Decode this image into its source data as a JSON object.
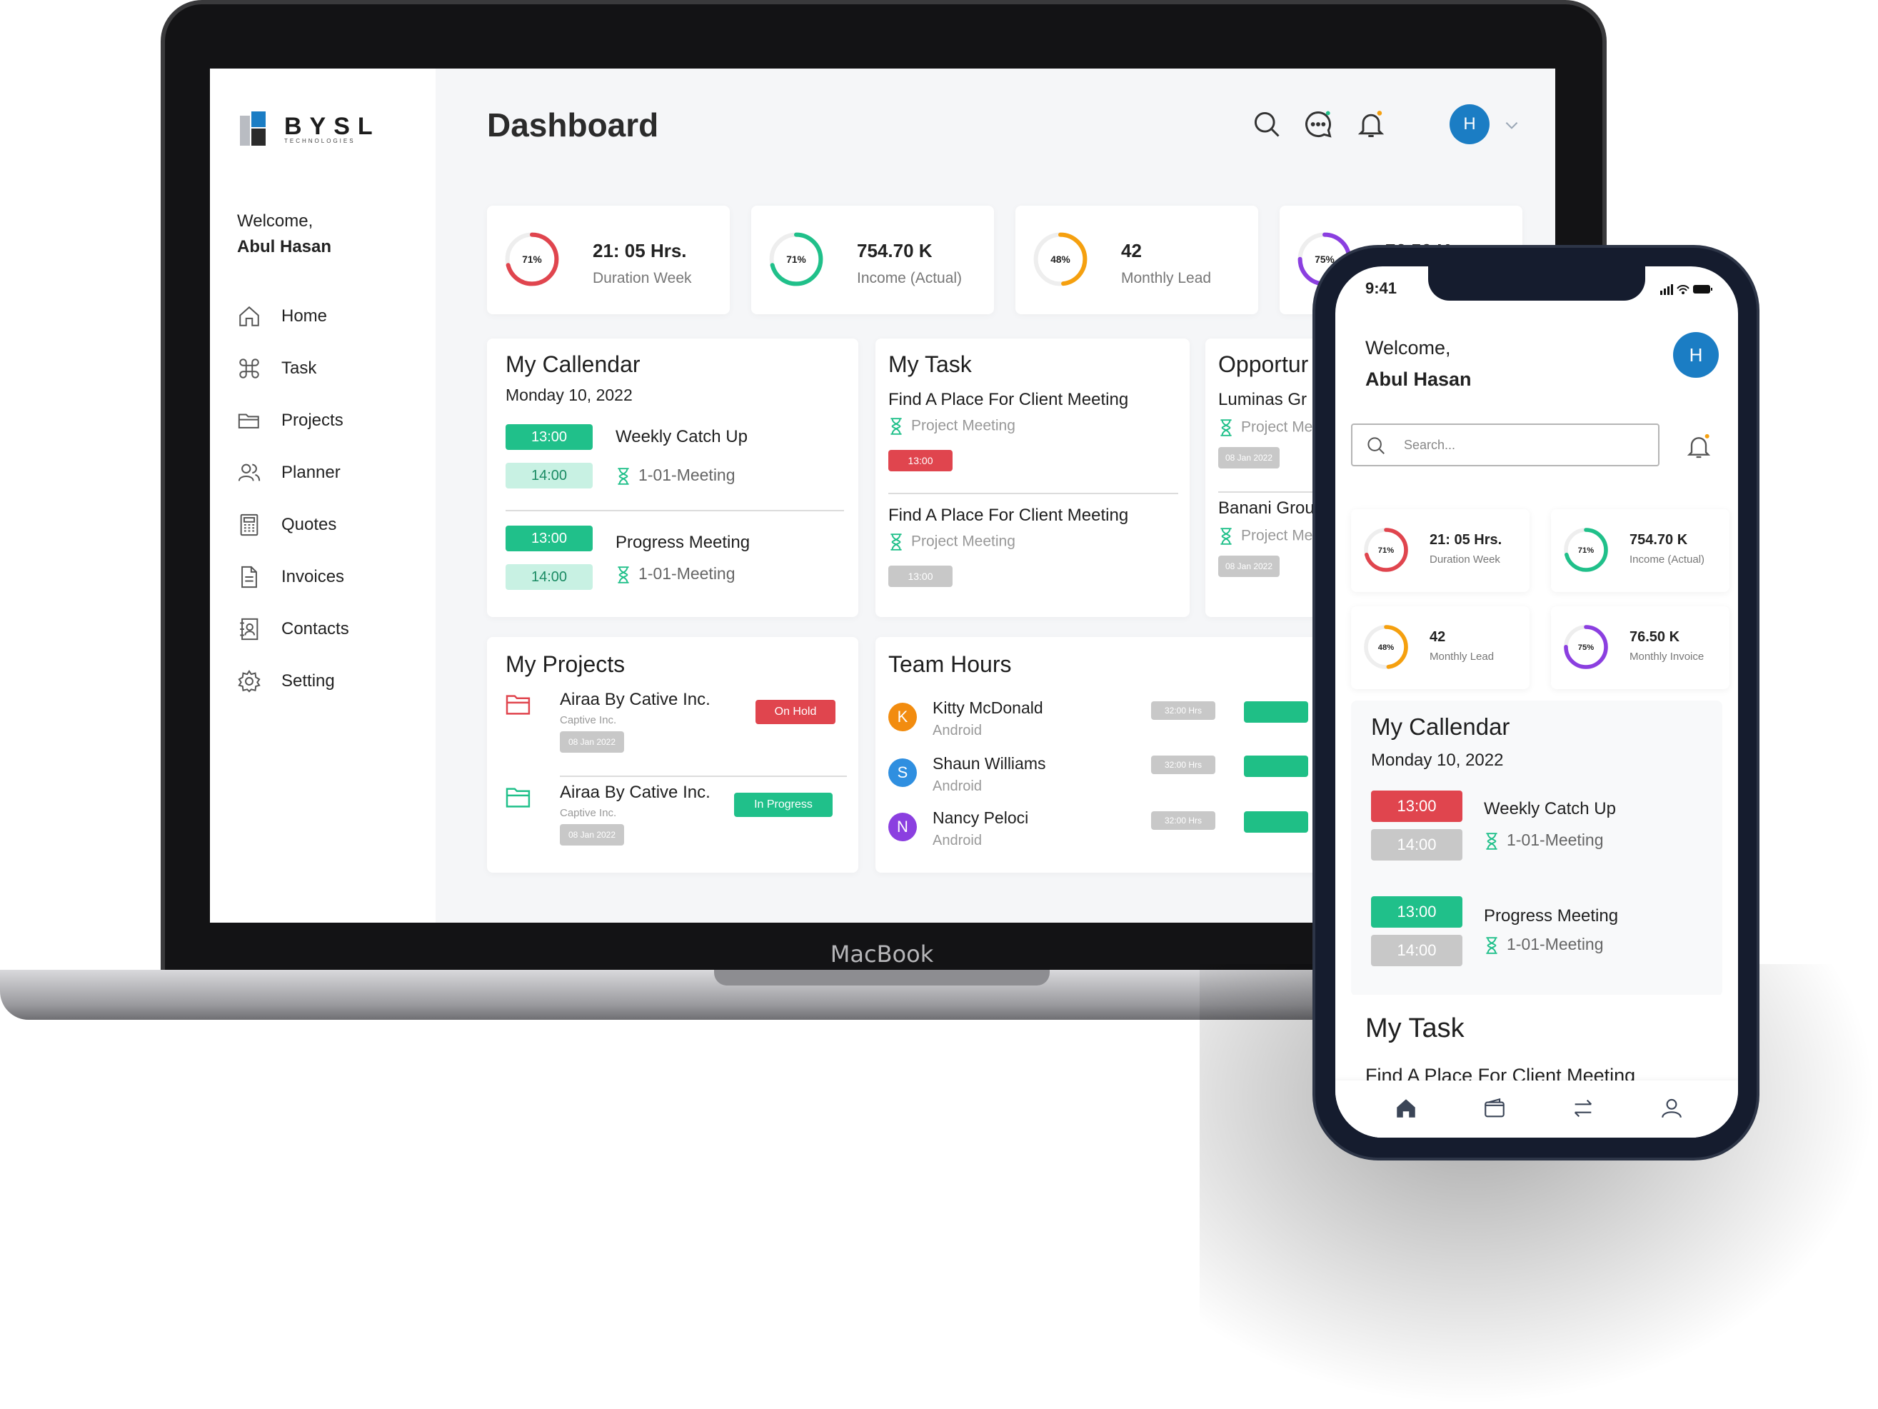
{
  "device_label": "MacBook",
  "brand": {
    "name": "BYSL",
    "tagline": "TECHNOLOGIES"
  },
  "welcome": {
    "greeting": "Welcome,",
    "name": "Abul Hasan"
  },
  "nav": [
    {
      "label": "Home",
      "icon": "home-icon"
    },
    {
      "label": "Task",
      "icon": "command-icon"
    },
    {
      "label": "Projects",
      "icon": "folder-icon"
    },
    {
      "label": "Planner",
      "icon": "users-icon"
    },
    {
      "label": "Quotes",
      "icon": "calculator-icon"
    },
    {
      "label": "Invoices",
      "icon": "document-icon"
    },
    {
      "label": "Contacts",
      "icon": "contact-book-icon"
    },
    {
      "label": "Setting",
      "icon": "gear-icon"
    }
  ],
  "header": {
    "title": "Dashboard",
    "avatar_initial": "H"
  },
  "stats": [
    {
      "percent_label": "71%",
      "percent": 0.71,
      "value": "21: 05 Hrs.",
      "label": "Duration Week",
      "color": "#e0454e"
    },
    {
      "percent_label": "71%",
      "percent": 0.71,
      "value": "754.70 K",
      "label": "Income (Actual)",
      "color": "#20c08a"
    },
    {
      "percent_label": "48%",
      "percent": 0.48,
      "value": "42",
      "label": "Monthly Lead",
      "color": "#f5a00f"
    },
    {
      "percent_label": "75%",
      "percent": 0.75,
      "value": "76.50 K",
      "label": "Monthly Invoice",
      "color": "#8b3fe0"
    }
  ],
  "calendar": {
    "title": "My Callendar",
    "date": "Monday 10, 2022",
    "events": [
      {
        "start": "13:00",
        "end": "14:00",
        "title": "Weekly Catch Up",
        "sub": "1-01-Meeting"
      },
      {
        "start": "13:00",
        "end": "14:00",
        "title": "Progress Meeting",
        "sub": "1-01-Meeting"
      }
    ]
  },
  "tasks": {
    "title": "My Task",
    "items": [
      {
        "title": "Find A Place For Client Meeting",
        "sub": "Project Meeting",
        "time": "13:00",
        "color": "#e0454e"
      },
      {
        "title": "Find A Place For Client Meeting",
        "sub": "Project Meeting",
        "time": "13:00",
        "color": "#c8c8c8"
      }
    ]
  },
  "opportunities": {
    "title": "Opportur",
    "items": [
      {
        "title": "Luminas Gr",
        "sub": "Project Me",
        "date": "08 Jan 2022"
      },
      {
        "title": "Banani Grou",
        "sub": "Project Me",
        "date": "08 Jan 2022"
      }
    ]
  },
  "projects": {
    "title": "My Projects",
    "items": [
      {
        "name": "Airaa By Cative Inc.",
        "company": "Captive Inc.",
        "date": "08 Jan 2022",
        "status": "On Hold",
        "status_color": "#e0454e",
        "icon_color": "#e0454e"
      },
      {
        "name": "Airaa By Cative Inc.",
        "company": "Captive Inc.",
        "date": "08 Jan 2022",
        "status": "In Progress",
        "status_color": "#20c08a",
        "icon_color": "#20c08a"
      }
    ]
  },
  "team_hours": {
    "title": "Team Hours",
    "members": [
      {
        "initial": "K",
        "name": "Kitty McDonald",
        "platform": "Android",
        "hours": "32:00 Hrs",
        "color": "#f28c0f"
      },
      {
        "initial": "S",
        "name": "Shaun Williams",
        "platform": "Android",
        "hours": "32:00 Hrs",
        "color": "#2f8fe0"
      },
      {
        "initial": "N",
        "name": "Nancy Peloci",
        "platform": "Android",
        "hours": "32:00 Hrs",
        "color": "#8b3fe0"
      }
    ]
  },
  "phone": {
    "time": "9:41",
    "search_placeholder": "Search...",
    "calendar_events": [
      {
        "start": "13:00",
        "end": "14:00",
        "title": "Weekly Catch Up",
        "sub": "1-01-Meeting",
        "start_color": "#e0454e"
      },
      {
        "start": "13:00",
        "end": "14:00",
        "title": "Progress Meeting",
        "sub": "1-01-Meeting",
        "start_color": "#20c08a"
      }
    ],
    "task_first": "Find A Place For Client Meeting",
    "tabbar": [
      "home-icon",
      "wallet-icon",
      "transfer-icon",
      "profile-icon"
    ]
  }
}
